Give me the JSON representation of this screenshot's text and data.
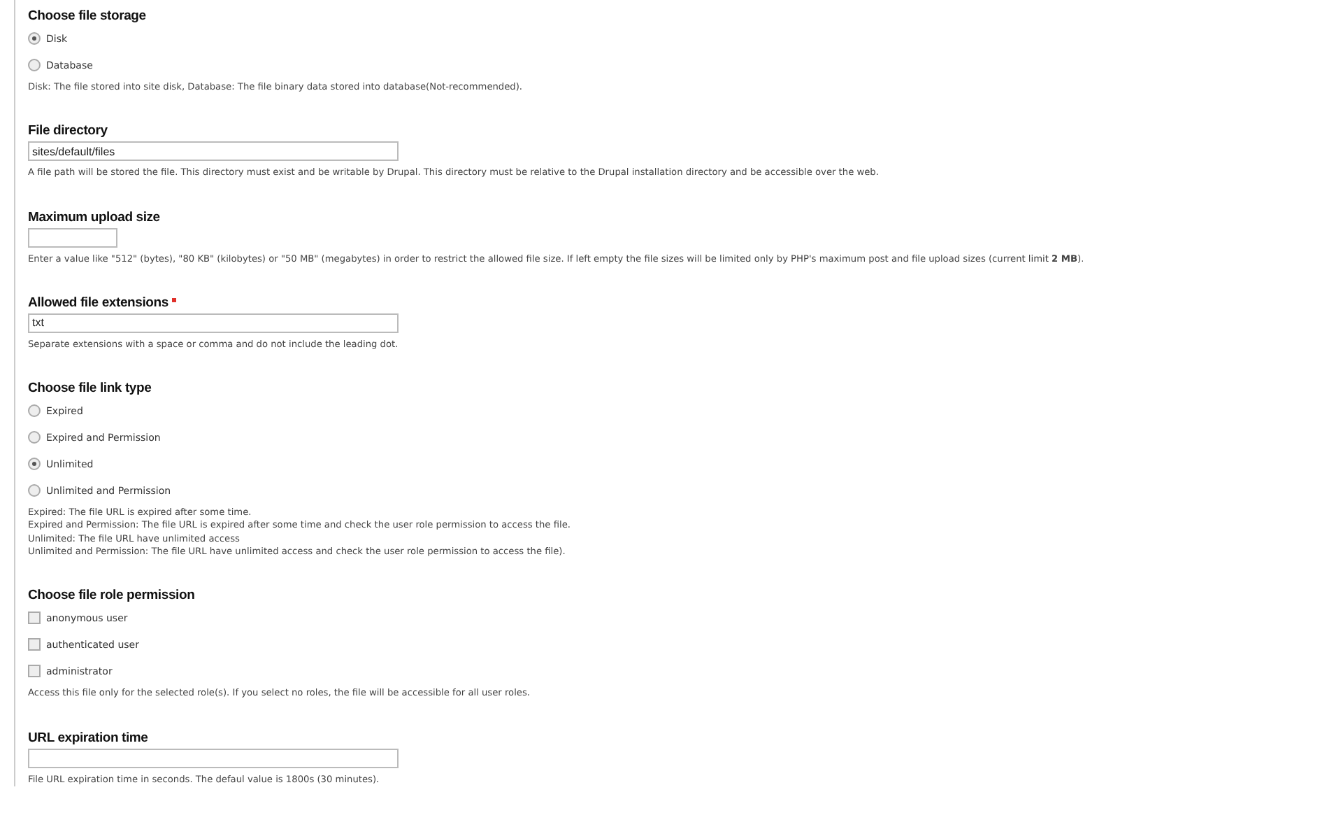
{
  "sections": [
    {
      "kind": "radios",
      "title": "Choose file storage",
      "required": false,
      "options": [
        {
          "label": "Disk",
          "selected": true
        },
        {
          "label": "Database",
          "selected": false
        }
      ],
      "description": [
        "Disk: The file stored into site disk, Database: The file binary data stored into database(Not-recommended)."
      ]
    },
    {
      "kind": "text",
      "title": "File directory",
      "required": false,
      "value": "sites/default/files",
      "wide": true,
      "description": [
        "A file path will be stored the file. This directory must exist and be writable by Drupal. This directory must be relative to the Drupal installation directory and be accessible over the web."
      ]
    },
    {
      "kind": "text",
      "title": "Maximum upload size",
      "required": false,
      "wide": false,
      "description": [
        "Enter a value like \"512\" (bytes), \"80 KB\" (kilobytes) or \"50 MB\" (megabytes) in order to restrict the allowed file size. If left empty the file sizes will be limited only by PHP's maximum post and file upload sizes (current limit **2 MB**)."
      ]
    },
    {
      "kind": "text",
      "title": "Allowed file extensions",
      "required": true,
      "value": "txt",
      "wide": true,
      "description": [
        "Separate extensions with a space or comma and do not include the leading dot."
      ]
    },
    {
      "kind": "radios",
      "title": "Choose file link type",
      "required": false,
      "options": [
        {
          "label": "Expired",
          "selected": false
        },
        {
          "label": "Expired and Permission",
          "selected": false
        },
        {
          "label": "Unlimited",
          "selected": true
        },
        {
          "label": "Unlimited and Permission",
          "selected": false
        }
      ],
      "description": [
        "Expired: The file URL is expired after some time.",
        "Expired and Permission: The file URL is expired after some time and check the user role permission to access the file.",
        "Unlimited: The file URL have unlimited access",
        "Unlimited and Permission: The file URL have unlimited access and check the user role permission to access the file)."
      ]
    },
    {
      "kind": "checkboxes",
      "title": "Choose file role permission",
      "required": false,
      "options": [
        {
          "label": "anonymous user",
          "checked": false
        },
        {
          "label": "authenticated user",
          "checked": false
        },
        {
          "label": "administrator",
          "checked": false
        }
      ],
      "description": [
        "Access this file only for the selected role(s). If you select no roles, the file will be accessible for all user roles."
      ]
    },
    {
      "kind": "text",
      "title": "URL expiration time",
      "required": false,
      "wide": true,
      "description": [
        "File URL expiration time in seconds. The defaul value is 1800s (30 minutes)."
      ]
    }
  ]
}
